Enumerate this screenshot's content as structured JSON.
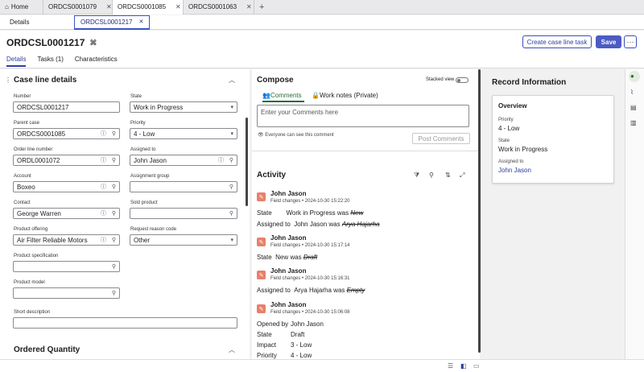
{
  "top_tabs": [
    {
      "label": "Home"
    },
    {
      "label": "ORDCS0001079"
    },
    {
      "label": "ORDCS0001085"
    },
    {
      "label": "ORDCS0001063"
    }
  ],
  "sub_tabs": {
    "details": "Details",
    "active": "ORDCSL0001217"
  },
  "header": {
    "title": "ORDCSL0001217",
    "create_btn": "Create case line task",
    "save_btn": "Save",
    "more_btn": "···"
  },
  "page_tabs": [
    "Details",
    "Tasks (1)",
    "Characteristics"
  ],
  "case_line": {
    "section_title": "Case line details",
    "fields": {
      "number_label": "Number",
      "number": "ORDCSL0001217",
      "state_label": "State",
      "state": "Work in Progress",
      "parent_label": "Parent case",
      "parent": "ORDCS0001085",
      "priority_label": "Priority",
      "priority": "4 - Low",
      "order_line_label": "Order line number",
      "order_line": "ORDL0001072",
      "assigned_label": "Assigned to",
      "assigned": "John Jason",
      "account_label": "Account",
      "account": "Boxeo",
      "group_label": "Assignment group",
      "group": "",
      "contact_label": "Contact",
      "contact": "George Warren",
      "sold_label": "Sold product",
      "sold": "",
      "offering_label": "Product offering",
      "offering": "Air Filter Reliable Motors",
      "reason_label": "Request reason code",
      "reason": "Other",
      "spec_label": "Product specification",
      "spec": "",
      "model_label": "Product model",
      "model": "",
      "short_label": "Short description",
      "short": ""
    },
    "ordered_title": "Ordered Quantity"
  },
  "compose": {
    "title": "Compose",
    "stacked": "Stacked view",
    "tab_comments": "Comments",
    "tab_notes": "Work notes (Private)",
    "placeholder": "Enter your Comments here",
    "visibility": "Everyone can see this comment",
    "post": "Post Comments"
  },
  "activity": {
    "title": "Activity",
    "entries": [
      {
        "name": "John Jason",
        "meta": "Field changes • 2024-10-30 15:22:20",
        "l1a": "State",
        "l1b": "Work in Progress was",
        "l1c": "New",
        "l2a": "Assigned to",
        "l2b": "John Jason was",
        "l2c": "Arya Hajarha"
      },
      {
        "name": "John Jason",
        "meta": "Field changes • 2024-10-30 15:17:14",
        "l1a": "State",
        "l1b": "New was",
        "l1c": "Draft"
      },
      {
        "name": "John Jason",
        "meta": "Field changes • 2024-10-30 15:16:31",
        "l1a": "Assigned to",
        "l1b": "Arya Hajarha was",
        "l1c": "Empty"
      },
      {
        "name": "John Jason",
        "meta": "Field changes • 2024-10-30 15:06:08",
        "r1a": "Opened by",
        "r1b": "John Jason",
        "r2a": "State",
        "r2b": "Draft",
        "r3a": "Impact",
        "r3b": "3 - Low",
        "r4a": "Priority",
        "r4b": "4 - Low"
      }
    ]
  },
  "record_info": {
    "title": "Record Information",
    "overview": "Overview",
    "priority_label": "Priority",
    "priority": "4 - Low",
    "state_label": "State",
    "state": "Work in Progress",
    "assigned_label": "Assigned to",
    "assigned": "John Jason"
  },
  "colors": {
    "accent": "#4c5bc3",
    "link": "#2c3e9c",
    "pencil": "#e8806a"
  }
}
